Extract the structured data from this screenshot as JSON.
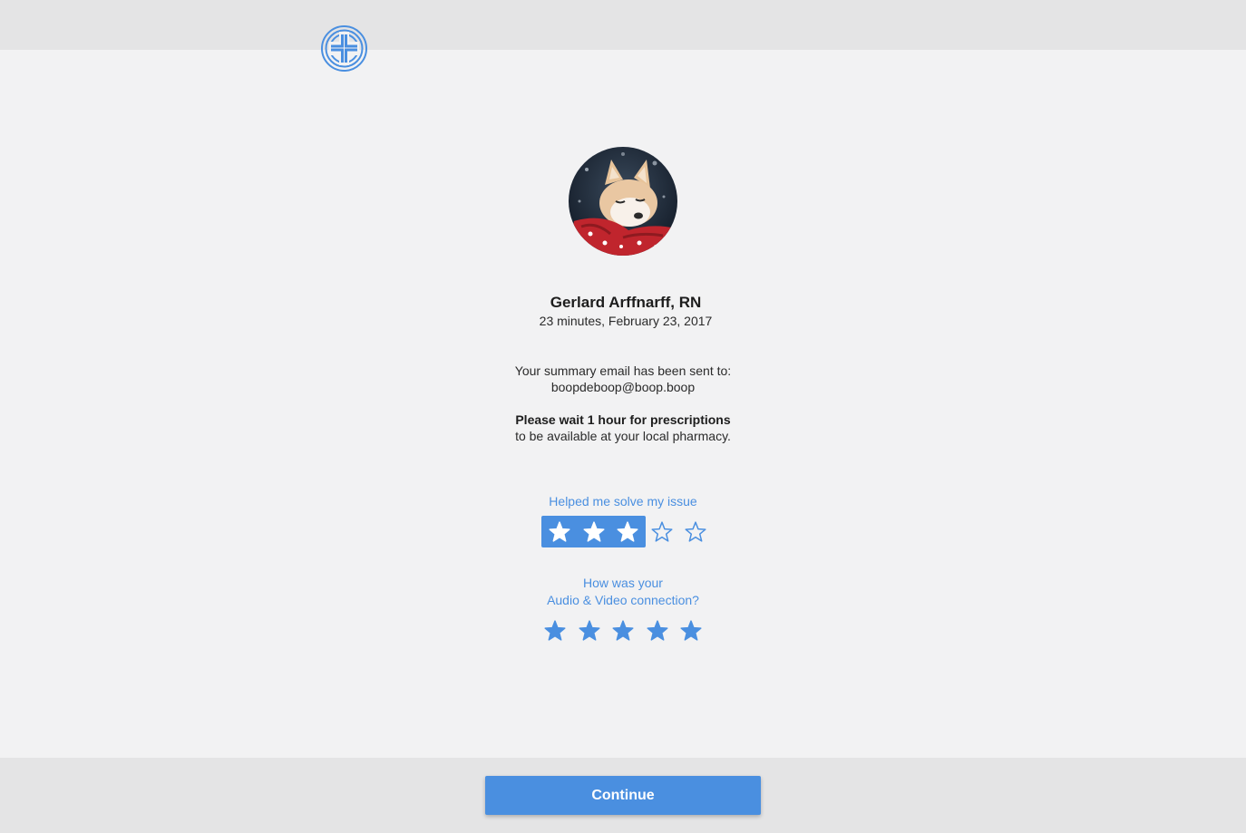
{
  "colors": {
    "accent": "#4a8fe0",
    "background": "#f2f2f3",
    "bars": "#e4e4e5"
  },
  "header": {
    "logo_icon": "medical-cross-logo-icon"
  },
  "provider": {
    "avatar_icon": "provider-avatar-photo",
    "name": "Gerlard Arffnarff, RN",
    "visit_meta": "23 minutes, February 23, 2017"
  },
  "summary": {
    "line": "Your summary email has been sent to:",
    "email": "boopdeboop@boop.boop",
    "prescription_bold": "Please wait 1 hour for prescriptions",
    "prescription_rest": "to be available at your local pharmacy."
  },
  "ratings": {
    "issue": {
      "label": "Helped me solve my issue",
      "value": 3,
      "max": 5
    },
    "connection": {
      "label_line1": "How was your",
      "label_line2": "Audio & Video connection?",
      "value": 5,
      "max": 5
    }
  },
  "footer": {
    "continue_label": "Continue"
  }
}
